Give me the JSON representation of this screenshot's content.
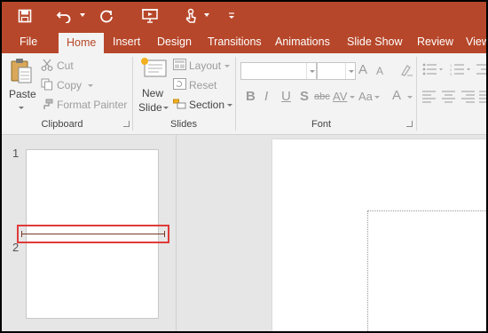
{
  "qat": {
    "save_icon": "save-icon",
    "undo_icon": "undo-icon",
    "redo_icon": "repeat-icon",
    "present_icon": "start-from-beginning-icon",
    "touch_icon": "touch-mode-icon",
    "customize_icon": "customize-qat-icon"
  },
  "tabs": [
    "File",
    "Home",
    "Insert",
    "Design",
    "Transitions",
    "Animations",
    "Slide Show",
    "Review",
    "View"
  ],
  "active_tab": "Home",
  "colors": {
    "accent": "#b7472a",
    "ribbon_bg": "#f3f3f3",
    "highlight": "#e03a3a"
  },
  "clipboard": {
    "paste_label": "Paste",
    "cut_label": "Cut",
    "copy_label": "Copy",
    "format_painter_label": "Format Painter",
    "group_label": "Clipboard"
  },
  "slides_group": {
    "new_slide_line1": "New",
    "new_slide_line2": "Slide",
    "layout_label": "Layout",
    "reset_label": "Reset",
    "section_label": "Section",
    "group_label": "Slides"
  },
  "font_group": {
    "font_name_value": "",
    "font_size_value": "",
    "bold": "B",
    "italic": "I",
    "underline": "U",
    "shadow": "S",
    "strikethrough": "abc",
    "spacing": "AV",
    "case": "Aa",
    "color": "A",
    "grow": "A",
    "shrink": "A",
    "group_label": "Font"
  },
  "slides": [
    {
      "number": "1"
    },
    {
      "number": "2"
    }
  ]
}
